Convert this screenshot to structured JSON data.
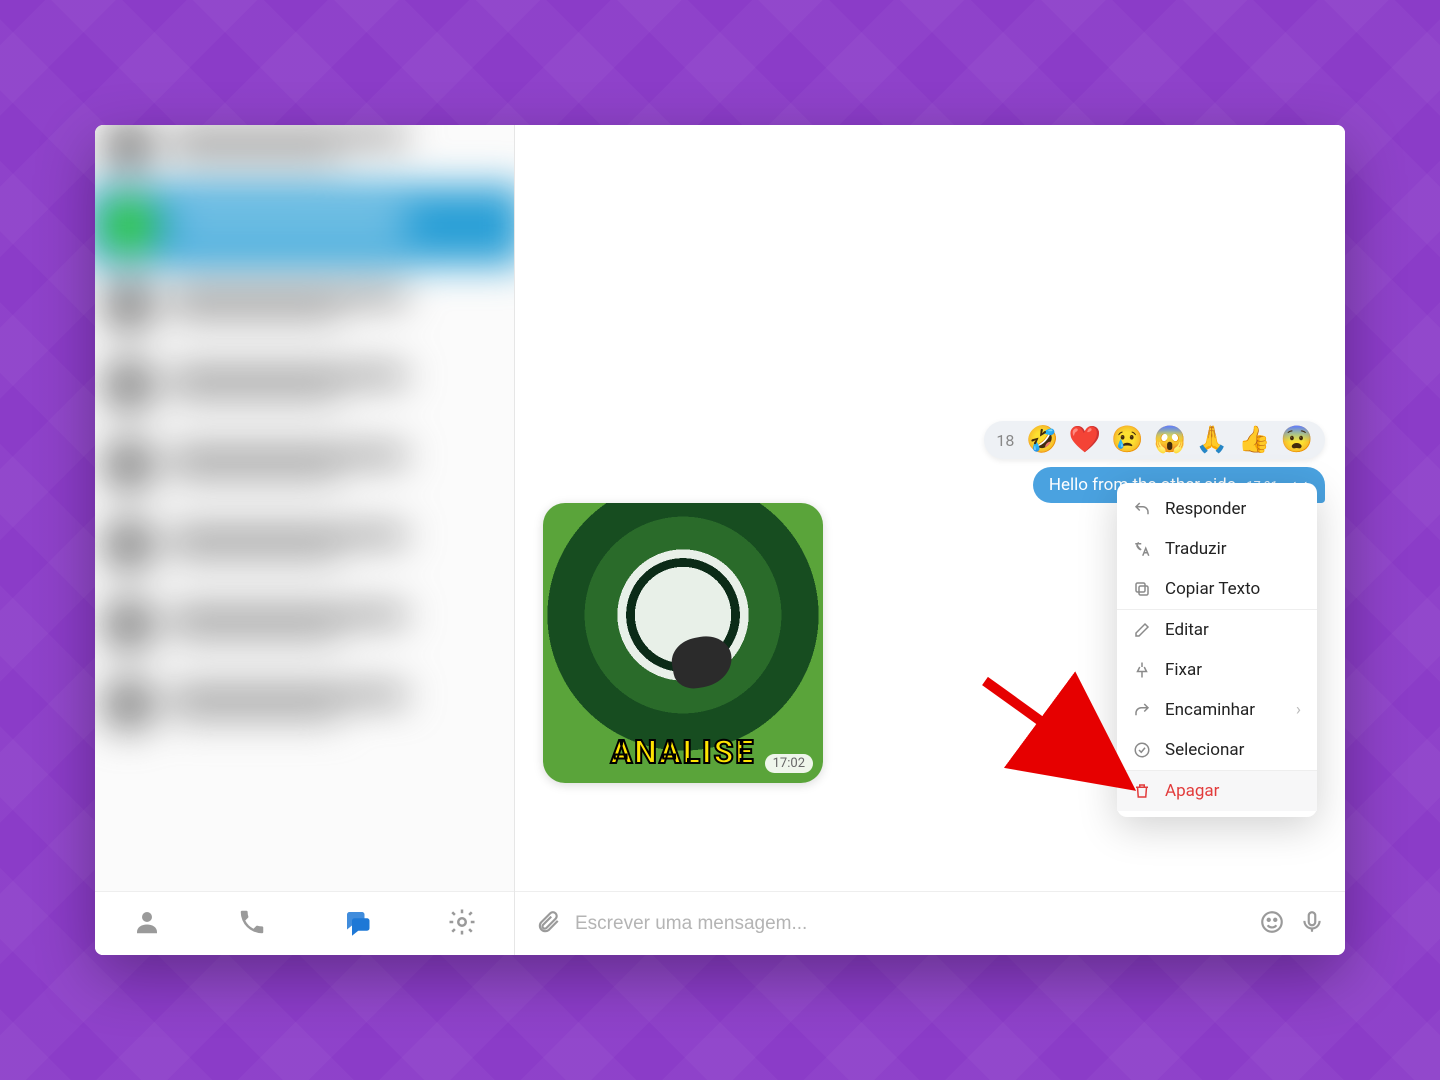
{
  "reaction_bar": {
    "count": "18",
    "emojis": [
      "🤣",
      "❤️",
      "😢",
      "😱",
      "🙏",
      "👍",
      "😨"
    ]
  },
  "bubble": {
    "text": "Hello from the other side",
    "time": "17:01",
    "checks": "✓✓"
  },
  "image_message": {
    "caption": "ANALISE",
    "time": "17:02"
  },
  "context_menu": {
    "responder": "Responder",
    "traduzir": "Traduzir",
    "copiar_texto": "Copiar Texto",
    "editar": "Editar",
    "fixar": "Fixar",
    "encaminhar": "Encaminhar",
    "selecionar": "Selecionar",
    "apagar": "Apagar"
  },
  "composer": {
    "placeholder": "Escrever uma mensagem..."
  }
}
